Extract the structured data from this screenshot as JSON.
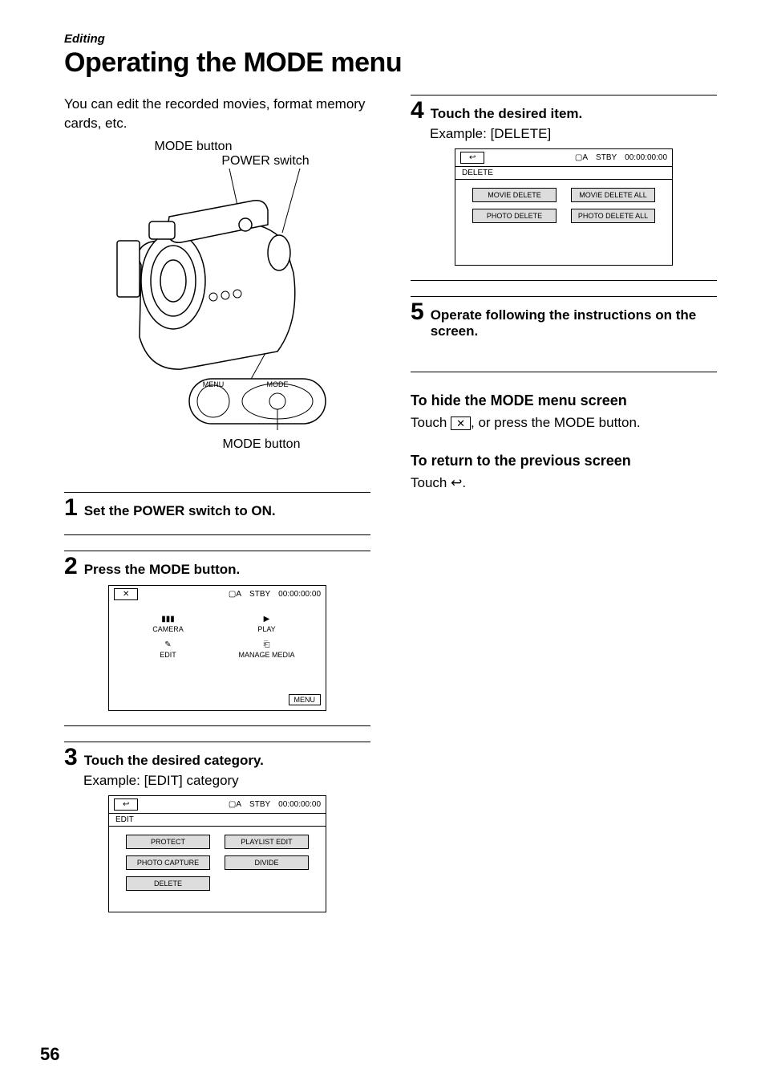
{
  "section_label": "Editing",
  "title": "Operating the MODE menu",
  "intro": "You can edit the recorded movies, format memory cards, etc.",
  "labels": {
    "mode_button_top": "MODE button",
    "power_switch": "POWER switch",
    "mode_button_bottom": "MODE button",
    "menu_text": "MENU",
    "mode_text": "MODE"
  },
  "steps": {
    "s1": {
      "num": "1",
      "text": "Set the POWER switch to ON."
    },
    "s2": {
      "num": "2",
      "text": "Press the MODE button."
    },
    "s3": {
      "num": "3",
      "text": "Touch the desired category.",
      "sub": "Example: [EDIT] category"
    },
    "s4": {
      "num": "4",
      "text": "Touch the desired item.",
      "sub": "Example: [DELETE]"
    },
    "s5": {
      "num": "5",
      "text": "Operate following the instructions on the screen."
    }
  },
  "lcd_common": {
    "close": "✕",
    "back": "↩",
    "card_a": "A",
    "stby": "STBY",
    "timecode": "00:00:00:00"
  },
  "lcd2": {
    "camera": "CAMERA",
    "play": "PLAY",
    "edit": "EDIT",
    "manage": "MANAGE MEDIA",
    "menu": "MENU"
  },
  "lcd3": {
    "title": "EDIT",
    "items": [
      "PROTECT",
      "PLAYLIST EDIT",
      "PHOTO CAPTURE",
      "DIVIDE",
      "DELETE"
    ]
  },
  "lcd4": {
    "title": "DELETE",
    "items": [
      "MOVIE DELETE",
      "MOVIE DELETE ALL",
      "PHOTO DELETE",
      "PHOTO DELETE ALL"
    ]
  },
  "sub1": {
    "head": "To hide the MODE menu screen",
    "text_a": "Touch ",
    "text_b": ", or press the MODE button."
  },
  "sub2": {
    "head": "To return to the previous screen",
    "text_a": "Touch ",
    "text_b": "."
  },
  "icon_x": "✕",
  "icon_back": "↩",
  "pagenum": "56"
}
